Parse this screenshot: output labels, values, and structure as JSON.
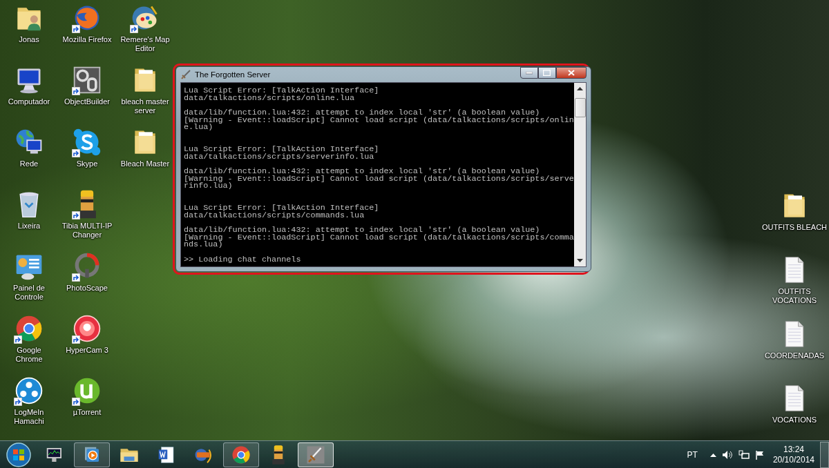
{
  "desktop": {
    "icons_left": [
      {
        "label": "Jonas",
        "kind": "user-folder",
        "shortcut": false
      },
      {
        "label": "Computador",
        "kind": "computer",
        "shortcut": false
      },
      {
        "label": "Rede",
        "kind": "network",
        "shortcut": false
      },
      {
        "label": "Lixeira",
        "kind": "recycle-bin",
        "shortcut": false
      },
      {
        "label": "Painel de Controle",
        "kind": "control-panel",
        "shortcut": false
      },
      {
        "label": "Google Chrome",
        "kind": "chrome",
        "shortcut": true
      },
      {
        "label": "LogMeIn Hamachi",
        "kind": "hamachi",
        "shortcut": true
      },
      {
        "label": "Mozilla Firefox",
        "kind": "firefox",
        "shortcut": true
      },
      {
        "label": "ObjectBuilder",
        "kind": "objectbuilder",
        "shortcut": true
      },
      {
        "label": "Skype",
        "kind": "skype",
        "shortcut": true
      },
      {
        "label": "Tibia MULTI-IP Changer",
        "kind": "character",
        "shortcut": true
      },
      {
        "label": "PhotoScape",
        "kind": "photoscape",
        "shortcut": true
      },
      {
        "label": "HyperCam 3",
        "kind": "hypercam",
        "shortcut": true
      },
      {
        "label": "µTorrent",
        "kind": "utorrent",
        "shortcut": true
      },
      {
        "label": "Remere's Map Editor",
        "kind": "map-editor",
        "shortcut": true
      },
      {
        "label": "bleach master server",
        "kind": "folder",
        "shortcut": false
      },
      {
        "label": "Bleach Master",
        "kind": "folder",
        "shortcut": false
      }
    ],
    "icons_right": [
      {
        "label": "OUTFITS BLEACH",
        "kind": "folder",
        "shortcut": false
      },
      {
        "label": "OUTFITS VOCATIONS",
        "kind": "document",
        "shortcut": false
      },
      {
        "label": "COORDENADAS",
        "kind": "document",
        "shortcut": false
      },
      {
        "label": "VOCATIONS",
        "kind": "document",
        "shortcut": false
      }
    ]
  },
  "window": {
    "title": "The Forgotten Server",
    "console_lines": [
      {
        "kind": "text",
        "text": "Lua Script Error: [TalkAction Interface]"
      },
      {
        "kind": "text",
        "text": "data/talkactions/scripts/online.lua"
      },
      {
        "kind": "blank"
      },
      {
        "kind": "text",
        "text": "data/lib/function.lua:432: attempt to index local 'str' (a boolean value)"
      },
      {
        "kind": "text",
        "text": "[Warning - Event::loadScript] Cannot load script (data/talkactions/scripts/onlin"
      },
      {
        "kind": "text",
        "text": "e.lua)"
      },
      {
        "kind": "blank"
      },
      {
        "kind": "blank"
      },
      {
        "kind": "text",
        "text": "Lua Script Error: [TalkAction Interface]"
      },
      {
        "kind": "text",
        "text": "data/talkactions/scripts/serverinfo.lua"
      },
      {
        "kind": "blank"
      },
      {
        "kind": "text",
        "text": "data/lib/function.lua:432: attempt to index local 'str' (a boolean value)"
      },
      {
        "kind": "text",
        "text": "[Warning - Event::loadScript] Cannot load script (data/talkactions/scripts/serve"
      },
      {
        "kind": "text",
        "text": "rinfo.lua)"
      },
      {
        "kind": "blank"
      },
      {
        "kind": "blank"
      },
      {
        "kind": "text",
        "text": "Lua Script Error: [TalkAction Interface]"
      },
      {
        "kind": "text",
        "text": "data/talkactions/scripts/commands.lua"
      },
      {
        "kind": "blank"
      },
      {
        "kind": "text",
        "text": "data/lib/function.lua:432: attempt to index local 'str' (a boolean value)"
      },
      {
        "kind": "text",
        "text": "[Warning - Event::loadScript] Cannot load script (data/talkactions/scripts/comma"
      },
      {
        "kind": "text",
        "text": "nds.lua)"
      },
      {
        "kind": "blank"
      },
      {
        "kind": "text",
        "text": ">> Loading chat channels"
      }
    ]
  },
  "taskbar": {
    "buttons": [
      {
        "kind": "task-manager",
        "running": false,
        "selected": false
      },
      {
        "kind": "media-player",
        "running": true,
        "selected": false
      },
      {
        "kind": "explorer",
        "running": false,
        "selected": false
      },
      {
        "kind": "word",
        "running": false,
        "selected": false
      },
      {
        "kind": "movie-maker",
        "running": false,
        "selected": false
      },
      {
        "kind": "chrome",
        "running": true,
        "selected": false
      },
      {
        "kind": "character",
        "running": false,
        "selected": false
      },
      {
        "kind": "sword",
        "running": true,
        "selected": true
      }
    ],
    "tray": {
      "language": "PT",
      "time": "13:24",
      "date": "20/10/2014"
    }
  }
}
